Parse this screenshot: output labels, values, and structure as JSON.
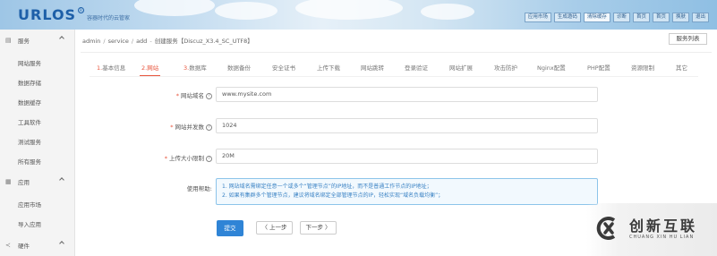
{
  "header": {
    "logo": "URLOS",
    "logo_mark": "R",
    "slogan": "容器时代的云管家",
    "nav": [
      "应用市场",
      "生成邀码",
      "清除缓存",
      "诊断",
      "首页",
      "首页",
      "换肤",
      "退出"
    ]
  },
  "sidebar": {
    "groups": [
      {
        "label": "服务",
        "icon": "server-icon",
        "items": [
          "网站服务",
          "数据存储",
          "数据缓存",
          "工具软件",
          "测试服务",
          "所有服务"
        ]
      },
      {
        "label": "应用",
        "icon": "grid-icon",
        "items": [
          "应用市场",
          "导入应用"
        ]
      },
      {
        "label": "硬件",
        "icon": "share-icon",
        "items": []
      }
    ]
  },
  "breadcrumb": {
    "items": [
      "admin",
      "service",
      "add",
      "创建服务【Discuz_X3.4_SC_UTF8】"
    ]
  },
  "service_list_button": "服务列表",
  "tabs": [
    {
      "num": "1.",
      "label": "基本信息"
    },
    {
      "num": "2.",
      "label": "网站"
    },
    {
      "num": "3.",
      "label": "数据库"
    },
    {
      "num": "",
      "label": "数据备份"
    },
    {
      "num": "",
      "label": "安全证书"
    },
    {
      "num": "",
      "label": "上传下载"
    },
    {
      "num": "",
      "label": "网站跳转"
    },
    {
      "num": "",
      "label": "登录验证"
    },
    {
      "num": "",
      "label": "网站扩展"
    },
    {
      "num": "",
      "label": "攻击防护"
    },
    {
      "num": "",
      "label": "Nginx配置"
    },
    {
      "num": "",
      "label": "PHP配置"
    },
    {
      "num": "",
      "label": "资源限制"
    },
    {
      "num": "",
      "label": "其它"
    }
  ],
  "form": {
    "domain": {
      "label": "网站域名",
      "value": "www.mysite.com"
    },
    "concurrency": {
      "label": "网站并发数",
      "value": "1024"
    },
    "upload_limit": {
      "label": "上传大小限制",
      "value": "20M"
    },
    "help": {
      "label": "使用帮助:",
      "lines": [
        "1. 网站域名需绑定任意一个或多个“管理节点”的IP地址，而不是普通工作节点的IP地址；",
        "2. 如果有集群多个管理节点，建议将域名绑定全部管理节点的IP，轻松实现“域名负载均衡”；"
      ]
    }
  },
  "buttons": {
    "submit": "提交",
    "prev": "〈 上一步",
    "next": "下一步 〉"
  },
  "watermark": {
    "cn": "创新互联",
    "en": "CHUANG XIN HU LIAN"
  },
  "colors": {
    "accent": "#e8543c",
    "primary": "#2f84d6",
    "notice_text": "#3a82c4"
  }
}
